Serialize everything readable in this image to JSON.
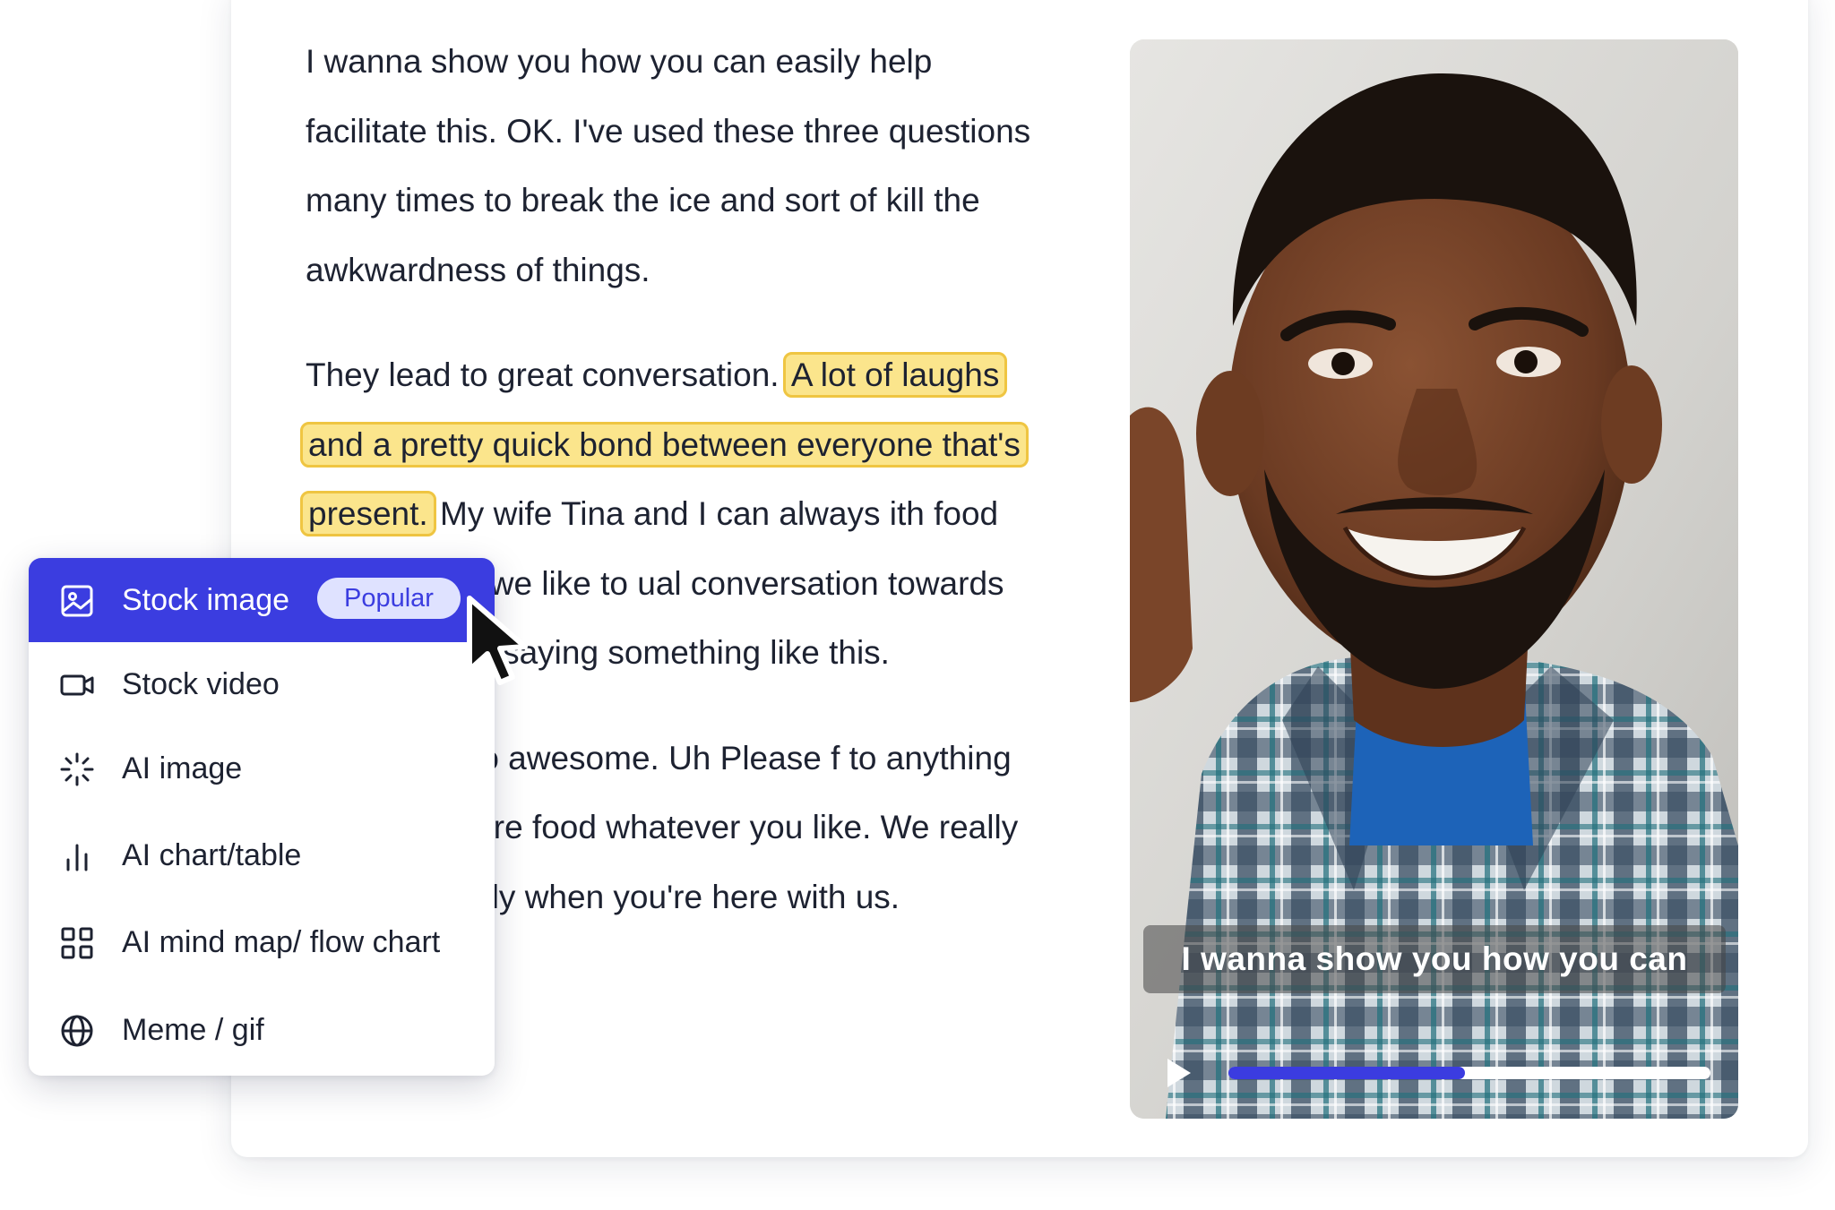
{
  "transcript": {
    "p1": {
      "text": "I wanna show you how you can easily help facilitate this. OK. I've used these three questions many times to break the ice and sort of kill the awkwardness of things."
    },
    "p2": {
      "before": "They lead to great conversation. ",
      "highlight": "A lot of laughs and a pretty quick bond between everyone that's present.",
      "after": " My wife Tina and I can always ith food and fun and we like to ual conversation towards these ons by saying something like this."
    },
    "p3": {
      "text": "me, this is so awesome. Uh Please f to anything you want more food whatever you like. We really want ke family when you're here with us."
    }
  },
  "video": {
    "caption": "I wanna show you how you can",
    "progress": 0.49,
    "colors": {
      "progress_fill": "#3b3ce0",
      "progress_track": "#ffffff"
    }
  },
  "menu": {
    "items": [
      {
        "label": "Stock image",
        "icon": "image-icon",
        "active": true,
        "badge": "Popular"
      },
      {
        "label": "Stock video",
        "icon": "video-camera-icon"
      },
      {
        "label": "AI image",
        "icon": "sparkle-icon"
      },
      {
        "label": "AI chart/table",
        "icon": "bar-chart-icon"
      },
      {
        "label": "AI mind map/ flow chart",
        "icon": "grid-icon"
      },
      {
        "label": "Meme / gif",
        "icon": "globe-icon"
      }
    ],
    "colors": {
      "accent": "#3b3de0",
      "badge_bg": "#dfe2ff"
    }
  },
  "colors": {
    "highlight_fill": "#fbe58c",
    "highlight_border": "#efc542",
    "text": "#1d2231"
  }
}
